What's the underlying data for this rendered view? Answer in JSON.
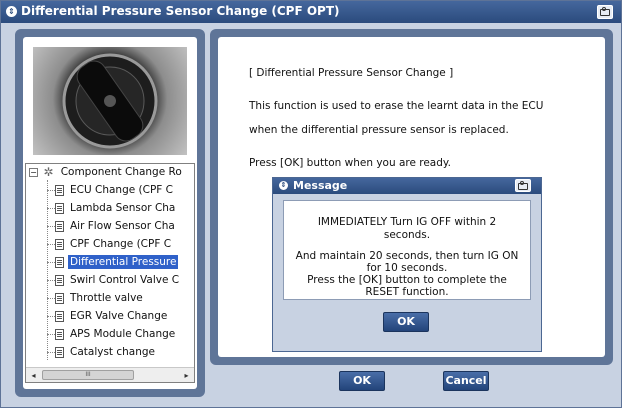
{
  "window": {
    "title": "Differential Pressure Sensor Change (CPF OPT)"
  },
  "tree": {
    "root_label": "Component Change Ro",
    "items": [
      {
        "label": "ECU Change (CPF C",
        "selected": false
      },
      {
        "label": "Lambda Sensor Cha",
        "selected": false
      },
      {
        "label": "Air Flow Sensor Cha",
        "selected": false
      },
      {
        "label": "CPF Change (CPF C",
        "selected": false
      },
      {
        "label": "Differential Pressure",
        "selected": true
      },
      {
        "label": "Swirl Control Valve C",
        "selected": false
      },
      {
        "label": "Throttle valve",
        "selected": false
      },
      {
        "label": "EGR Valve Change",
        "selected": false
      },
      {
        "label": "APS Module Change",
        "selected": false
      },
      {
        "label": "Catalyst change",
        "selected": false
      }
    ],
    "scroll_left": "◂",
    "scroll_right": "▸",
    "scroll_thumb": "III"
  },
  "content": {
    "heading": "[ Differential Pressure Sensor Change ]",
    "line1": "This function is used to erase the learnt data in the ECU",
    "line2": "when the differential pressure sensor is replaced.",
    "line3": "Press [OK] button when you are ready."
  },
  "buttons": {
    "ok": "OK",
    "cancel": "Cancel"
  },
  "dialog": {
    "title": "Message",
    "lines": [
      "IMMEDIATELY Turn IG OFF within 2",
      "seconds.",
      "And maintain 20 seconds, then turn IG ON",
      "for 10 seconds.",
      "Press the [OK] button to complete the",
      "RESET function."
    ],
    "ok": "OK"
  },
  "colors": {
    "accent": "#2b4b7d",
    "frame": "#5f7598",
    "selection": "#2f61c9",
    "background": "#c8d2e2"
  }
}
